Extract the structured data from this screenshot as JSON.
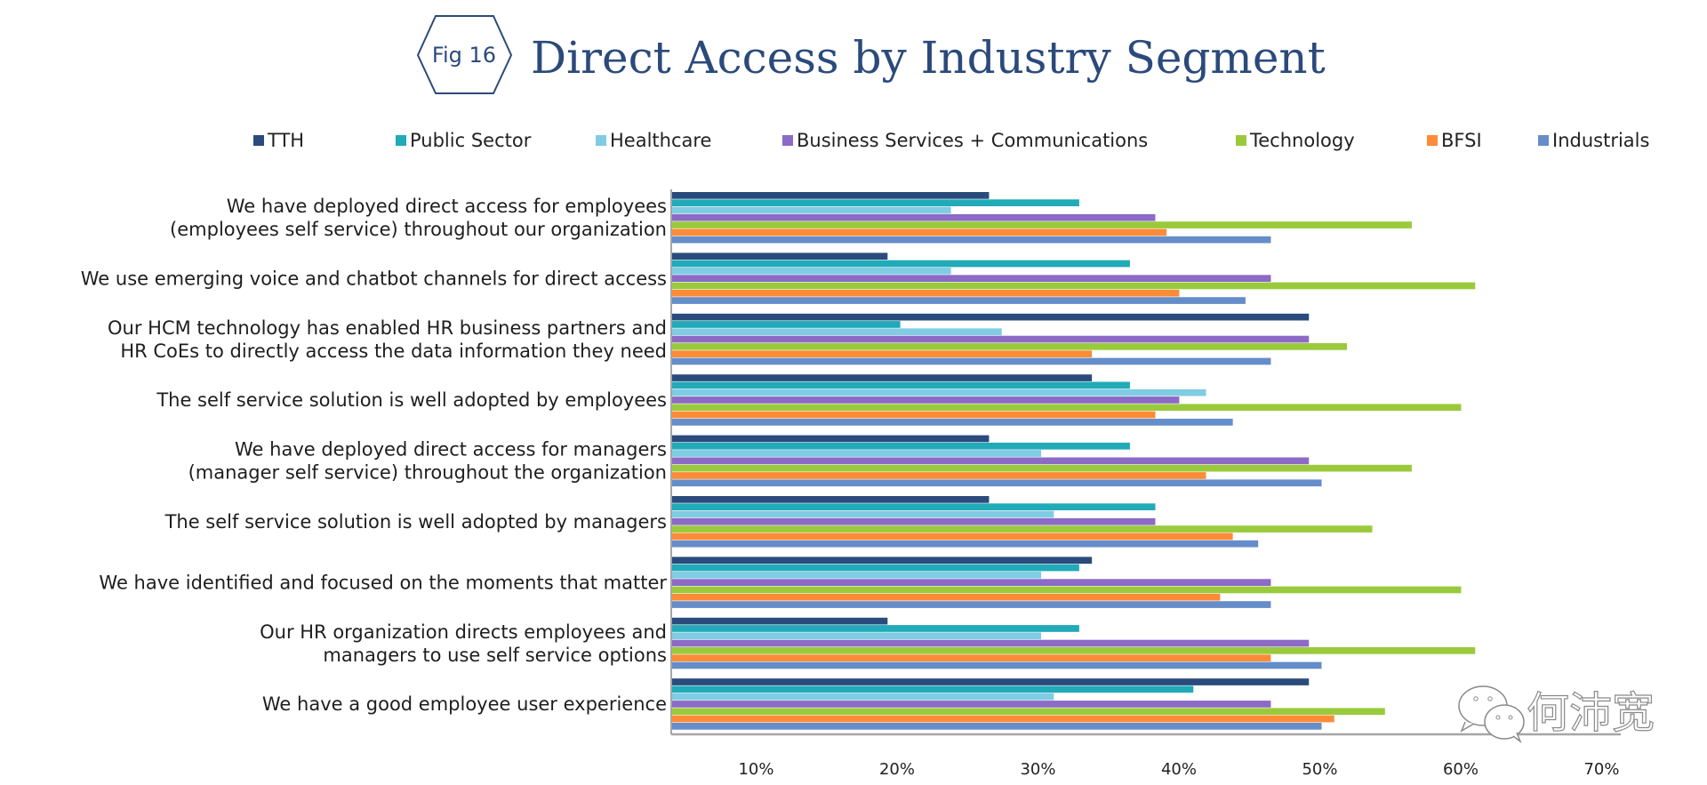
{
  "figure_badge": "Fig 16",
  "watermark": {
    "icon": "wechat-icon",
    "text": "何沛宽"
  },
  "colors": {
    "title": "#2b4a7b",
    "axis": "#a6a6a6"
  },
  "chart_data": {
    "type": "bar",
    "orientation": "horizontal",
    "title": "Direct Access by Industry Segment",
    "xlabel": "",
    "ylabel": "",
    "xlim": [
      0,
      70
    ],
    "x_ticks": [
      "10%",
      "20%",
      "30%",
      "40%",
      "50%",
      "60%",
      "70%"
    ],
    "x_tick_values": [
      10,
      20,
      30,
      40,
      50,
      60,
      70
    ],
    "grid": false,
    "legend_position": "top",
    "categories": [
      [
        "We have deployed direct access for employees",
        "(employees self service) throughout our organization"
      ],
      [
        "We use emerging voice and chatbot channels for direct access"
      ],
      [
        "Our HCM technology has enabled HR business partners and",
        "HR CoEs to directly access the data information they need"
      ],
      [
        "The self service solution is well adopted by employees"
      ],
      [
        "We have deployed direct access for managers",
        "(manager self service) throughout the organization"
      ],
      [
        "The self service solution is well adopted by managers"
      ],
      [
        "We have identified and focused on the moments that matter"
      ],
      [
        "Our HR organization directs employees and",
        "managers to use self service options"
      ],
      [
        "We have a good employee user experience"
      ]
    ],
    "series": [
      {
        "name": "TTH",
        "color": "#2a4b7c",
        "values": [
          26.4,
          19.2,
          49.1,
          33.7,
          26.4,
          26.4,
          33.7,
          19.2,
          49.1
        ]
      },
      {
        "name": "Public Sector",
        "color": "#21aab8",
        "values": [
          32.8,
          36.4,
          20.1,
          36.4,
          36.4,
          38.2,
          32.8,
          32.8,
          40.9
        ]
      },
      {
        "name": "Healthcare",
        "color": "#80cce3",
        "values": [
          23.7,
          23.7,
          27.3,
          41.8,
          30.1,
          31.0,
          30.1,
          30.1,
          31.0
        ]
      },
      {
        "name": "Business Services + Communications",
        "color": "#8c6ac6",
        "values": [
          38.2,
          46.4,
          49.1,
          39.9,
          49.1,
          38.2,
          46.4,
          49.1,
          46.4
        ]
      },
      {
        "name": "Technology",
        "color": "#9aca3c",
        "values": [
          56.4,
          60.9,
          51.8,
          59.9,
          56.4,
          53.6,
          59.9,
          60.9,
          54.5
        ]
      },
      {
        "name": "BFSI",
        "color": "#fd8b37",
        "values": [
          39.0,
          39.9,
          33.7,
          38.2,
          41.8,
          43.7,
          42.8,
          46.4,
          50.9
        ]
      },
      {
        "name": "Industrials",
        "color": "#658dc9",
        "values": [
          46.4,
          44.6,
          46.4,
          43.7,
          50.0,
          45.5,
          46.4,
          50.0,
          50.0
        ]
      }
    ]
  }
}
